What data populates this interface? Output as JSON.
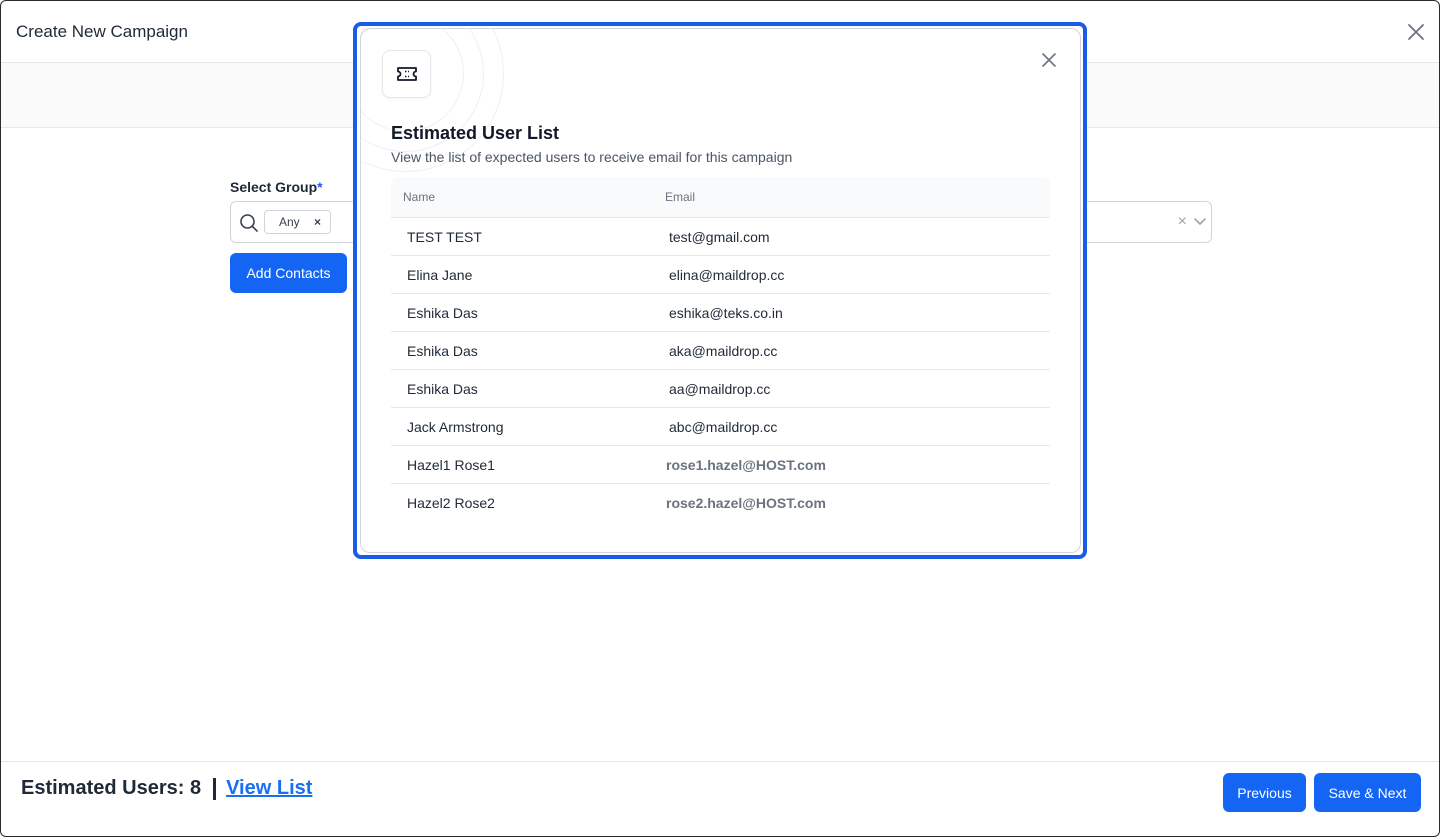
{
  "header": {
    "title": "Create New Campaign"
  },
  "form": {
    "label": "Select Group",
    "required_mark": "*",
    "chip": "Any",
    "chip_remove": "×",
    "clear": "×",
    "add_contacts": "Add Contacts"
  },
  "footer": {
    "estimated_label": "Estimated Users: 8",
    "view_list": "View List",
    "previous": "Previous",
    "save_next": "Save & Next"
  },
  "modal": {
    "title": "Estimated User List",
    "subtitle": "View the list of expected users to receive email for this campaign",
    "columns": [
      "Name",
      "Email"
    ],
    "rows": [
      {
        "name": "TEST TEST",
        "email": "test@gmail.com"
      },
      {
        "name": "Elina Jane",
        "email": "elina@maildrop.cc"
      },
      {
        "name": "Eshika Das",
        "email": "eshika@teks.co.in"
      },
      {
        "name": "Eshika Das",
        "email": "aka@maildrop.cc"
      },
      {
        "name": "Eshika Das",
        "email": "aa@maildrop.cc"
      },
      {
        "name": "Jack Armstrong",
        "email": "abc@maildrop.cc"
      },
      {
        "name": "Hazel1 Rose1",
        "email": "rose1.hazel@HOST.com"
      },
      {
        "name": "Hazel2 Rose2",
        "email": "rose2.hazel@HOST.com"
      }
    ]
  },
  "colors": {
    "primary": "#1565f4",
    "modal_outline": "#1a5ce6",
    "link": "#1a6ef0"
  },
  "icons": {
    "close": "close-icon",
    "search": "search-icon",
    "ticket": "ticket-icon",
    "chevron": "chevron-down-icon"
  }
}
